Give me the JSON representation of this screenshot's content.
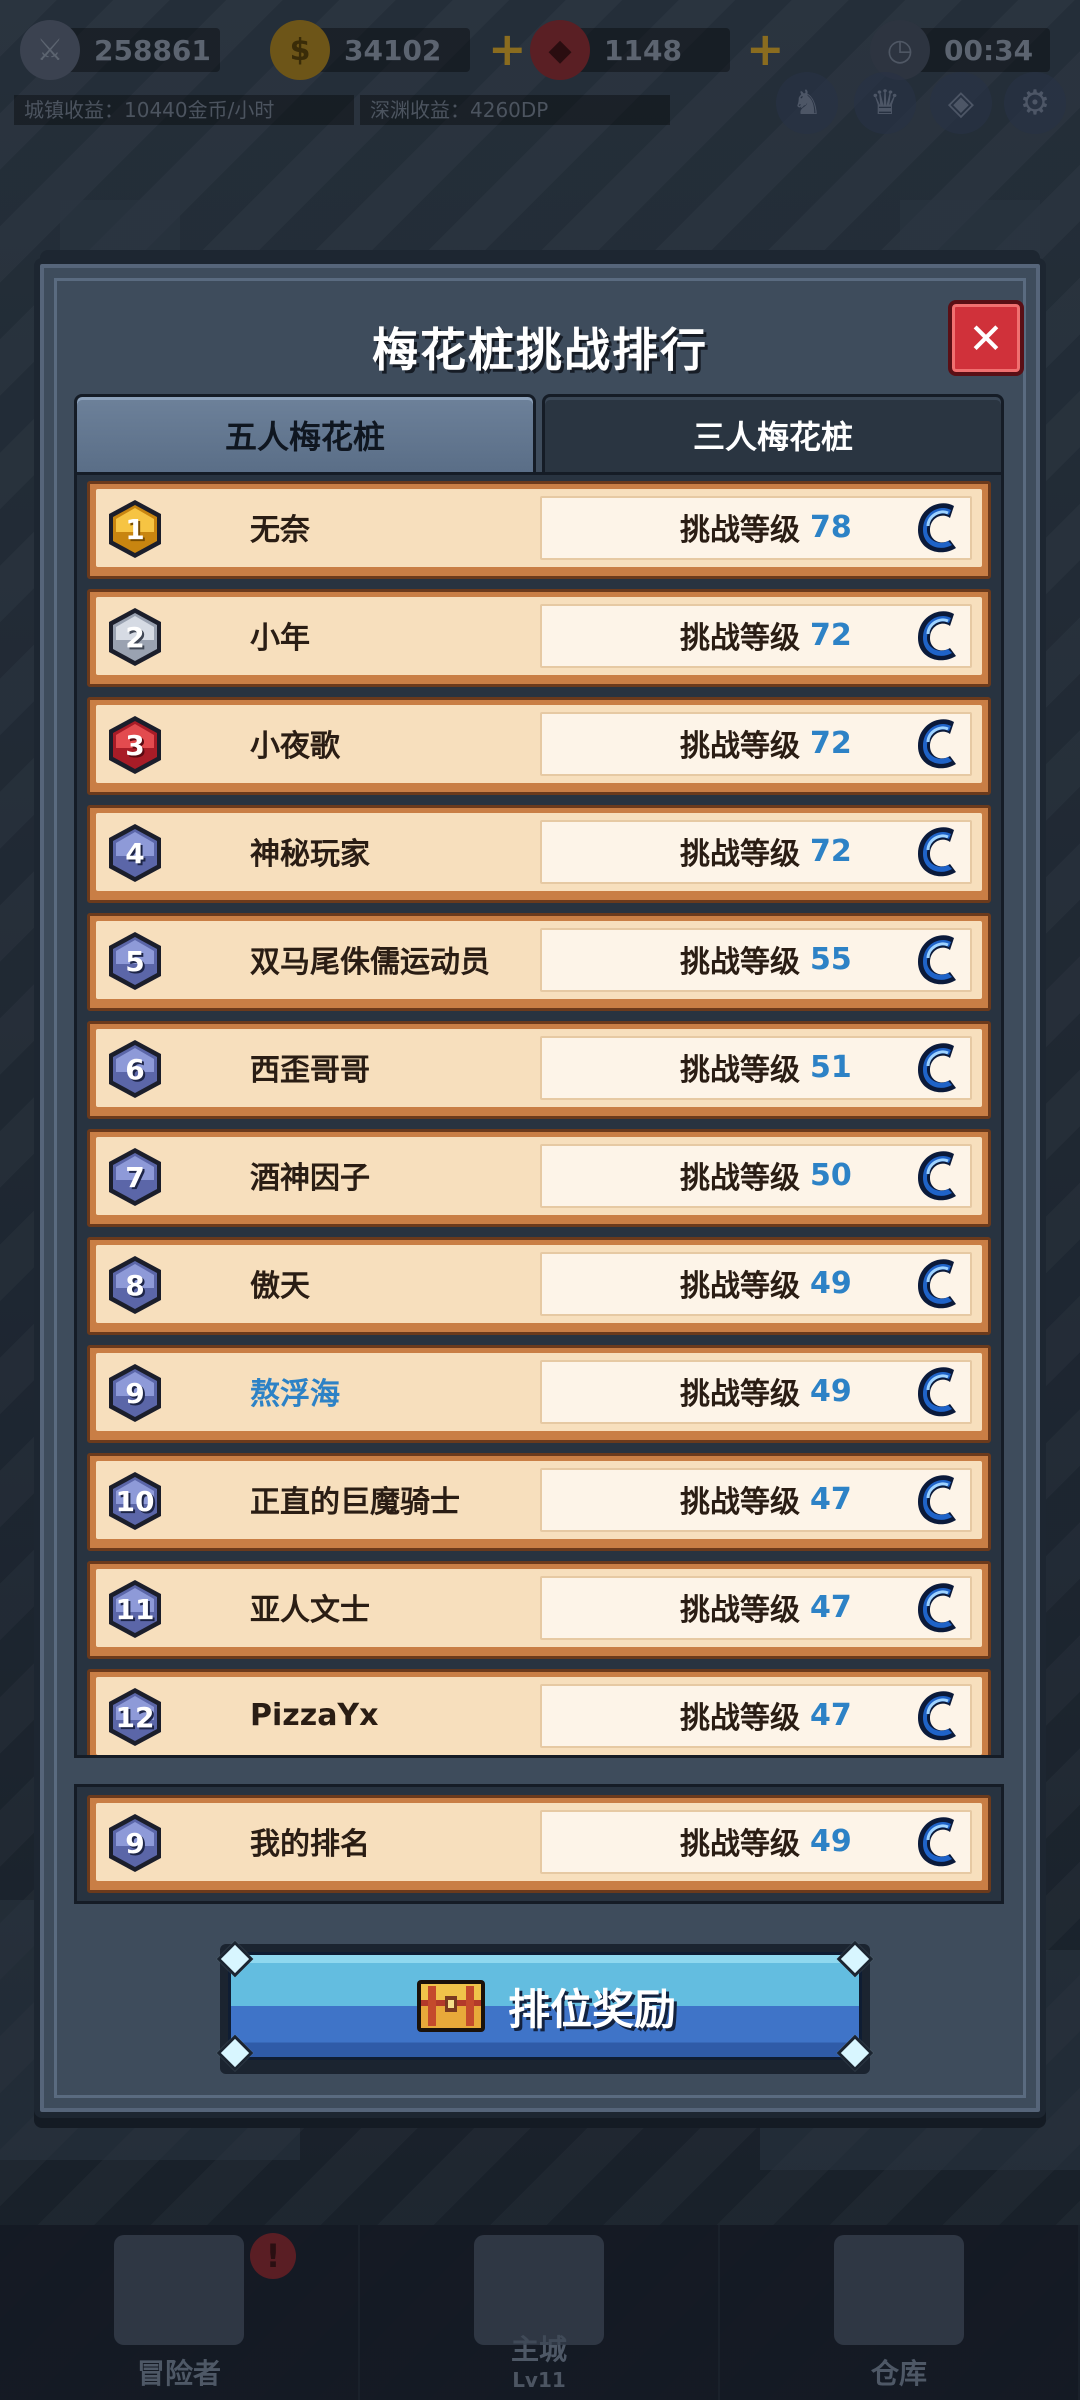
{
  "hud": {
    "power": "258861",
    "gold": "34102",
    "gems": "1148",
    "timer": "00:34",
    "town_income": "城镇收益：10440金币/小时",
    "abyss_income": "深渊收益：4260DP"
  },
  "modal": {
    "title": "梅花桩挑战排行",
    "close_icon": "close-icon",
    "tabs": [
      {
        "label": "五人梅花桩",
        "active": true
      },
      {
        "label": "三人梅花桩",
        "active": false
      }
    ],
    "level_label": "挑战等级",
    "ranking": [
      {
        "rank": "1",
        "name": "无奈",
        "level": "78",
        "badge": "gold"
      },
      {
        "rank": "2",
        "name": "小年",
        "level": "72",
        "badge": "silver"
      },
      {
        "rank": "3",
        "name": "小夜歌",
        "level": "72",
        "badge": "red"
      },
      {
        "rank": "4",
        "name": "神秘玩家",
        "level": "72",
        "badge": "blue"
      },
      {
        "rank": "5",
        "name": "双马尾侏儒运动员",
        "level": "55",
        "badge": "blue"
      },
      {
        "rank": "6",
        "name": "西歪哥哥",
        "level": "51",
        "badge": "blue"
      },
      {
        "rank": "7",
        "name": "酒神因子",
        "level": "50",
        "badge": "blue"
      },
      {
        "rank": "8",
        "name": "傲天",
        "level": "49",
        "badge": "blue"
      },
      {
        "rank": "9",
        "name": "熬浮海",
        "level": "49",
        "badge": "blue",
        "is_me": true
      },
      {
        "rank": "10",
        "name": "正直的巨魔骑士",
        "level": "47",
        "badge": "blue"
      },
      {
        "rank": "11",
        "name": "亚人文士",
        "level": "47",
        "badge": "blue"
      },
      {
        "rank": "12",
        "name": "PizzaYx",
        "level": "47",
        "badge": "blue"
      }
    ],
    "my_rank": {
      "rank": "9",
      "name": "我的排名",
      "level": "49",
      "badge": "blue"
    },
    "reward_button": "排位奖励"
  },
  "bottom_nav": {
    "items": [
      {
        "label": "冒险者",
        "sub": ""
      },
      {
        "label": "主城",
        "sub": "Lv11"
      },
      {
        "label": "仓库",
        "sub": ""
      }
    ],
    "alert": "!"
  },
  "colors": {
    "level_blue": "#2d82c6",
    "row_border": "#c97e45",
    "row_fill": "#f7dfbd",
    "badge_gold": "#f2b233",
    "badge_silver": "#c4cad6",
    "badge_red": "#d9343f",
    "badge_blue": "#7b86c8",
    "reward_blue": "#3f74c8"
  },
  "icons": {
    "grade": "c-grade-icon",
    "chest": "treasure-chest-icon",
    "timer": "clock-icon",
    "settings": "gear-icon"
  }
}
